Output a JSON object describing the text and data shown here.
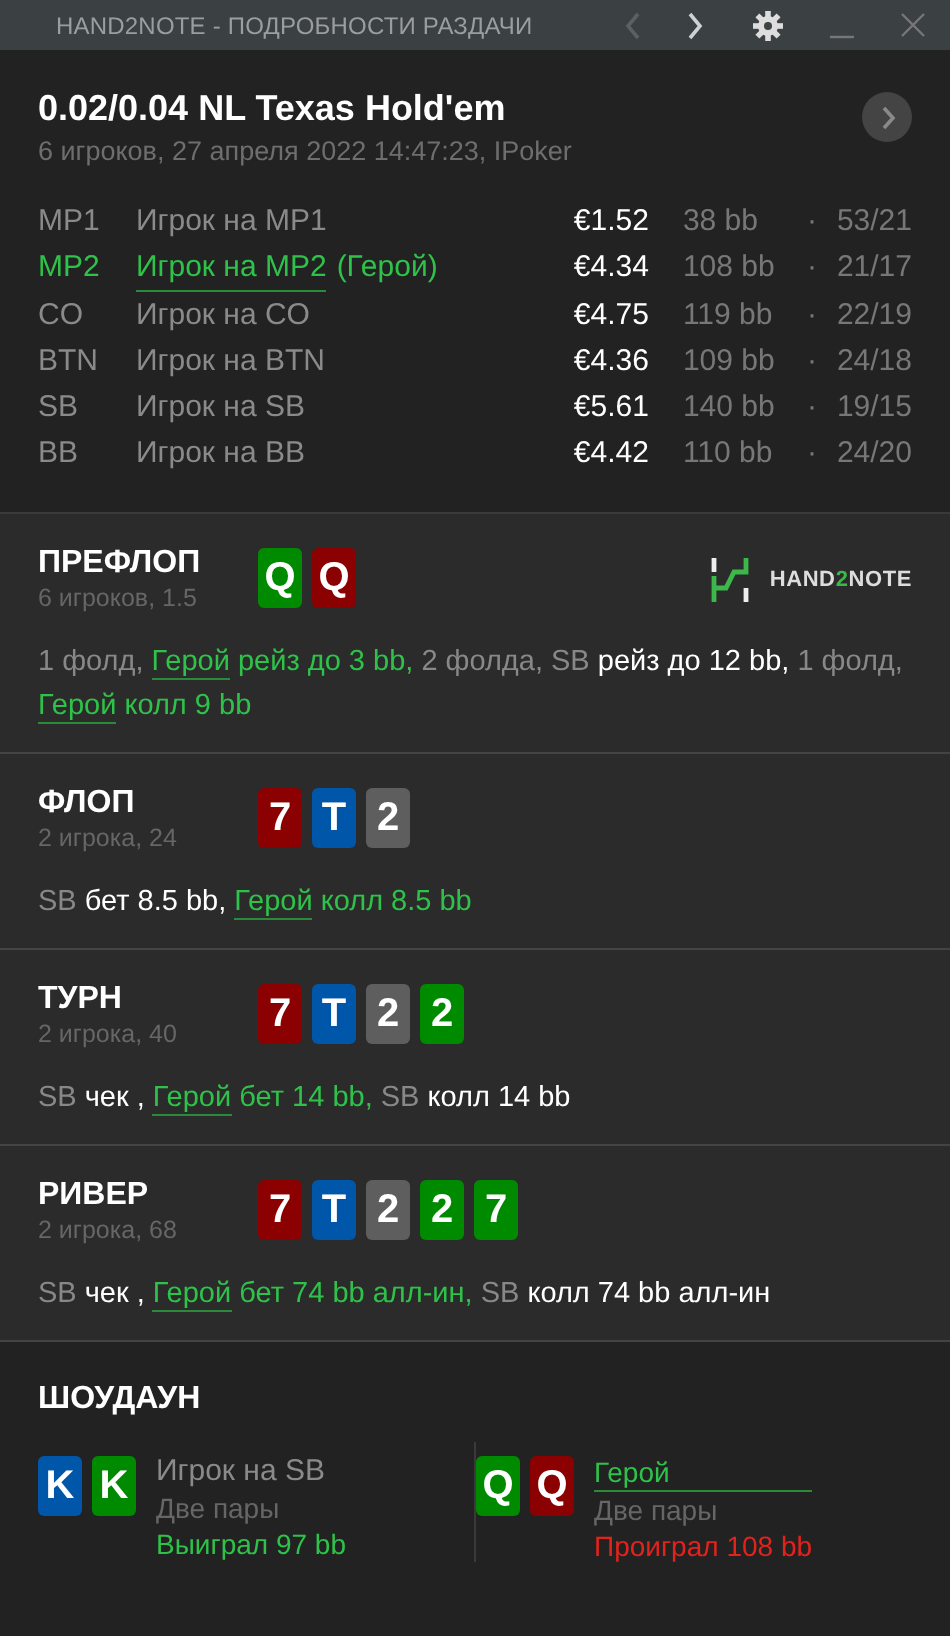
{
  "window": {
    "title": "HAND2NOTE - ПОДРОБНОСТИ РАЗДАЧИ",
    "nav": [
      {
        "kind": "prev",
        "disabled": true
      },
      {
        "kind": "next",
        "disabled": false
      }
    ]
  },
  "hand": {
    "title": "0.02/0.04 NL Texas Hold'em",
    "subtitle": "6 игроков, 27 апреля 2022 14:47:23, IPoker"
  },
  "players": [
    {
      "position": "MP1",
      "name": "Игрок на MP1",
      "hero": false,
      "stack": "€1.52",
      "bb": "38 bb",
      "separator": "·",
      "stats": "53/21"
    },
    {
      "position": "MP2",
      "name": "Игрок на MP2",
      "hero": true,
      "hero_tag": "(Герой)",
      "stack": "€4.34",
      "bb": "108 bb",
      "separator": "·",
      "stats": "21/17"
    },
    {
      "position": "CO",
      "name": "Игрок на CO",
      "hero": false,
      "stack": "€4.75",
      "bb": "119 bb",
      "separator": "·",
      "stats": "22/19"
    },
    {
      "position": "BTN",
      "name": "Игрок на BTN",
      "hero": false,
      "stack": "€4.36",
      "bb": "109 bb",
      "separator": "·",
      "stats": "24/18"
    },
    {
      "position": "SB",
      "name": "Игрок на SB",
      "hero": false,
      "stack": "€5.61",
      "bb": "140 bb",
      "separator": "·",
      "stats": "19/15"
    },
    {
      "position": "BB",
      "name": "Игрок на BB",
      "hero": false,
      "stack": "€4.42",
      "bb": "110 bb",
      "separator": "·",
      "stats": "24/20"
    }
  ],
  "streets": [
    {
      "name": "ПРЕФЛОП",
      "info": "6 игроков, 1.5",
      "logo": [
        {
          "text": "HAND",
          "accent": false
        },
        {
          "text": "2",
          "accent": true
        },
        {
          "text": "NOTE",
          "accent": false
        }
      ],
      "cards": [
        {
          "rank": "Q",
          "color": "#008a00"
        },
        {
          "rank": "Q",
          "color": "#8b0000"
        }
      ],
      "actions": [
        {
          "kind": "plain",
          "text": "1 фолд, "
        },
        {
          "kind": "hero",
          "text": "Герой"
        },
        {
          "kind": "hero_action",
          "text": " рейз до 3 bb, "
        },
        {
          "kind": "plain",
          "text": "2 фолда, SB"
        },
        {
          "kind": "action",
          "text": " рейз до 12 bb, "
        },
        {
          "kind": "plain",
          "text": "1 фолд, "
        },
        {
          "kind": "hero",
          "text": "Герой"
        },
        {
          "kind": "hero_action",
          "text": " колл 9 bb"
        }
      ]
    },
    {
      "name": "ФЛОП",
      "info": "2 игрока, 24",
      "cards": [
        {
          "rank": "7",
          "color": "#8b0000"
        },
        {
          "rank": "T",
          "color": "#0056a8"
        },
        {
          "rank": "2",
          "color": "#5e5e5e"
        }
      ],
      "actions": [
        {
          "kind": "plain",
          "text": "SB"
        },
        {
          "kind": "action",
          "text": " бет 8.5 bb, "
        },
        {
          "kind": "hero",
          "text": "Герой"
        },
        {
          "kind": "hero_action",
          "text": " колл 8.5 bb"
        }
      ]
    },
    {
      "name": "ТУРН",
      "info": "2 игрока, 40",
      "cards": [
        {
          "rank": "7",
          "color": "#8b0000"
        },
        {
          "rank": "T",
          "color": "#0056a8"
        },
        {
          "rank": "2",
          "color": "#5e5e5e"
        },
        {
          "rank": "2",
          "color": "#008a00"
        }
      ],
      "actions": [
        {
          "kind": "plain",
          "text": "SB"
        },
        {
          "kind": "action",
          "text": " чек , "
        },
        {
          "kind": "hero",
          "text": "Герой"
        },
        {
          "kind": "hero_action",
          "text": " бет 14 bb, "
        },
        {
          "kind": "plain",
          "text": "SB"
        },
        {
          "kind": "action",
          "text": " колл 14 bb"
        }
      ]
    },
    {
      "name": "РИВЕР",
      "info": "2 игрока, 68",
      "cards": [
        {
          "rank": "7",
          "color": "#8b0000"
        },
        {
          "rank": "T",
          "color": "#0056a8"
        },
        {
          "rank": "2",
          "color": "#5e5e5e"
        },
        {
          "rank": "2",
          "color": "#008a00"
        },
        {
          "rank": "7",
          "color": "#008a00"
        }
      ],
      "actions": [
        {
          "kind": "plain",
          "text": "SB"
        },
        {
          "kind": "action",
          "text": " чек , "
        },
        {
          "kind": "hero",
          "text": "Герой"
        },
        {
          "kind": "hero_action",
          "text": " бет 74 bb алл-ин, "
        },
        {
          "kind": "plain",
          "text": "SB"
        },
        {
          "kind": "action",
          "text": " колл 74 bb алл-ин"
        }
      ]
    }
  ],
  "showdown": {
    "title": "ШОУДАУН",
    "players": [
      {
        "name": "Игрок на SB",
        "hero": false,
        "hand": "Две пары",
        "result": "Выиграл 97 bb",
        "won": true,
        "cards": [
          {
            "rank": "K",
            "color": "#0056a8"
          },
          {
            "rank": "K",
            "color": "#008a00"
          }
        ]
      },
      {
        "name": "Герой",
        "hero": true,
        "hand": "Две пары",
        "result": "Проиграл 108 bb",
        "won": false,
        "cards": [
          {
            "rank": "Q",
            "color": "#008a00"
          },
          {
            "rank": "Q",
            "color": "#8b0000"
          }
        ]
      }
    ]
  }
}
